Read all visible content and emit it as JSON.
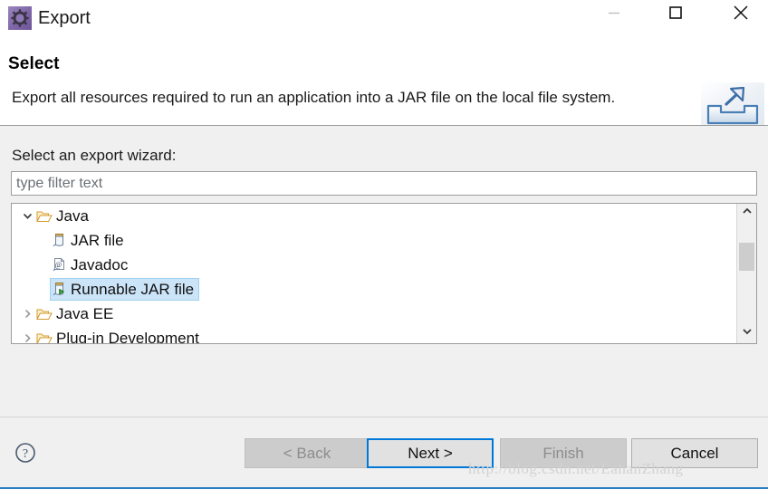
{
  "window": {
    "title": "Export",
    "app_icon": "eclipse-gear-icon",
    "controls": {
      "minimize_label": "—",
      "maximize_label": "□",
      "close_label": "✕"
    },
    "accent_color": "#2a7ec4",
    "title_icon_color": "#7e66a8"
  },
  "header": {
    "title": "Select",
    "description": "Export all resources required to run an application into a JAR file on the local file system.",
    "icon": "export-tray-arrow-icon",
    "icon_color": "#4a7fb5"
  },
  "body": {
    "wizard_label": "Select an export wizard:",
    "filter": {
      "value": "",
      "placeholder": "type filter text"
    },
    "tree": {
      "selection_color": "#cce4f7",
      "rows": [
        {
          "label": "Java",
          "depth": 0,
          "twisty": "chevron-down-icon",
          "icon": "folder-open-icon",
          "selected": false
        },
        {
          "label": "JAR file",
          "depth": 1,
          "twisty": "none",
          "icon": "jar-file-icon",
          "selected": false
        },
        {
          "label": "Javadoc",
          "depth": 1,
          "twisty": "none",
          "icon": "javadoc-icon",
          "selected": false
        },
        {
          "label": "Runnable JAR file",
          "depth": 1,
          "twisty": "none",
          "icon": "runnable-jar-icon",
          "selected": true
        },
        {
          "label": "Java EE",
          "depth": 0,
          "twisty": "chevron-right-icon",
          "icon": "folder-open-icon",
          "selected": false
        },
        {
          "label": "Plug-in Development",
          "depth": 0,
          "twisty": "chevron-right-icon",
          "icon": "folder-open-icon",
          "selected": false
        }
      ],
      "scrollbar": {
        "up_icon": "chevron-up-icon",
        "down_icon": "chevron-down-icon",
        "thumb_color": "#cdcdcd"
      }
    }
  },
  "footer": {
    "help_icon": "help-question-icon",
    "buttons": [
      {
        "label": "< Back",
        "state": "disabled"
      },
      {
        "label": "Next >",
        "state": "focused"
      },
      {
        "label": "Finish",
        "state": "disabled"
      },
      {
        "label": "Cancel",
        "state": "normal"
      }
    ]
  },
  "watermark": "http://blog.csdn.net/EahanZhang"
}
